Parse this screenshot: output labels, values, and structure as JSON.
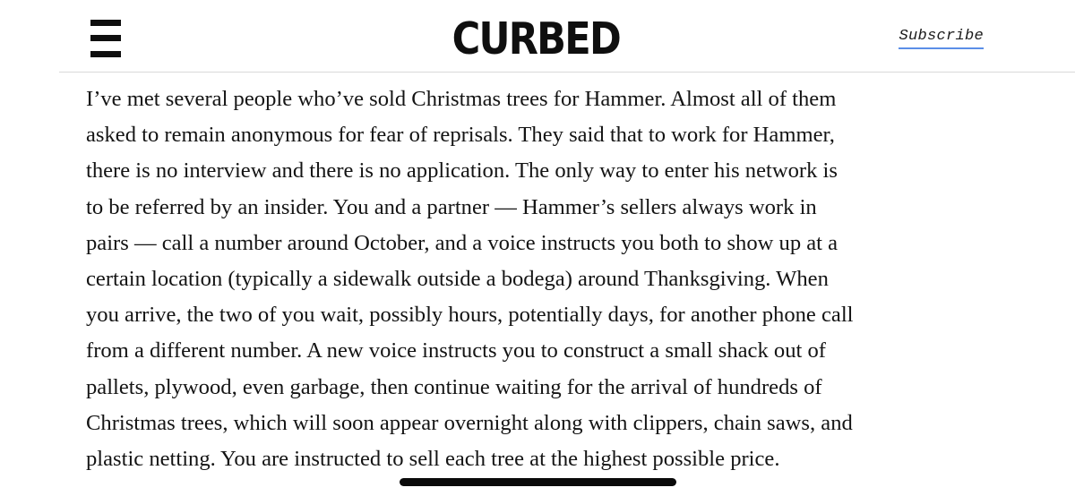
{
  "header": {
    "logo_text": "CURBED",
    "subscribe_label": "Subscribe",
    "menu_icon": "hamburger-menu-icon"
  },
  "article": {
    "lines": [
      "I’ve met several people who’ve sold Christmas trees for Hammer. Almost all of them",
      "asked to remain anonymous for fear of reprisals. They said that to work for Hammer,",
      "there is no interview and there is no application. The only way to enter his network is",
      "to be referred by an insider. You and a partner — Hammer’s sellers always work in",
      "pairs — call a number around October, and a voice instructs you both to show up at a",
      "certain location (typically a sidewalk outside a bodega) around Thanksgiving. When",
      "you arrive, the two of you wait, possibly hours, potentially days, for another phone call",
      "from a different number. A new voice instructs you to construct a small shack out of",
      "pallets, plywood, even garbage, then continue waiting for the arrival of hundreds of",
      "Christmas trees, which will soon appear overnight along with clippers, chain saws, and",
      "plastic netting. You are instructed to sell each tree at the highest possible price."
    ]
  },
  "colors": {
    "text": "#141414",
    "logo": "#0f0f0f",
    "subscribe_underline": "#5b8fe8",
    "divider": "#d9d9d9"
  }
}
